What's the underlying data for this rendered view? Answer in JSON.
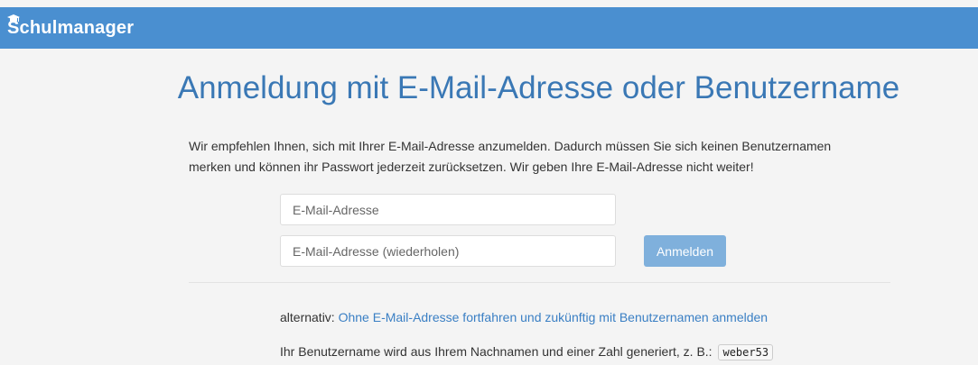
{
  "header": {
    "brand": "Schulmanager",
    "brand_color": "#4a8fd0"
  },
  "main": {
    "title": "Anmeldung mit E-Mail-Adresse oder Benutzername",
    "intro": "Wir empfehlen Ihnen, sich mit Ihrer E-Mail-Adresse anzumelden. Dadurch müssen Sie sich keinen Benutzernamen merken und können ihr Passwort jederzeit zurücksetzen. Wir geben Ihre E-Mail-Adresse nicht weiter!",
    "email_placeholder": "E-Mail-Adresse",
    "email_value": "",
    "email_repeat_placeholder": "E-Mail-Adresse (wiederholen)",
    "email_repeat_value": "",
    "login_label": "Anmelden",
    "alt_prefix": "alternativ: ",
    "alt_link": "Ohne E-Mail-Adresse fortfahren und zukünftig mit Benutzernamen anmelden",
    "username_text": "Ihr Benutzername wird aus Ihrem Nachnamen und einer Zahl generiert, z. B.:",
    "username_example": "weber53"
  },
  "icons": {
    "brand_icon": "graduation-cap-icon"
  }
}
